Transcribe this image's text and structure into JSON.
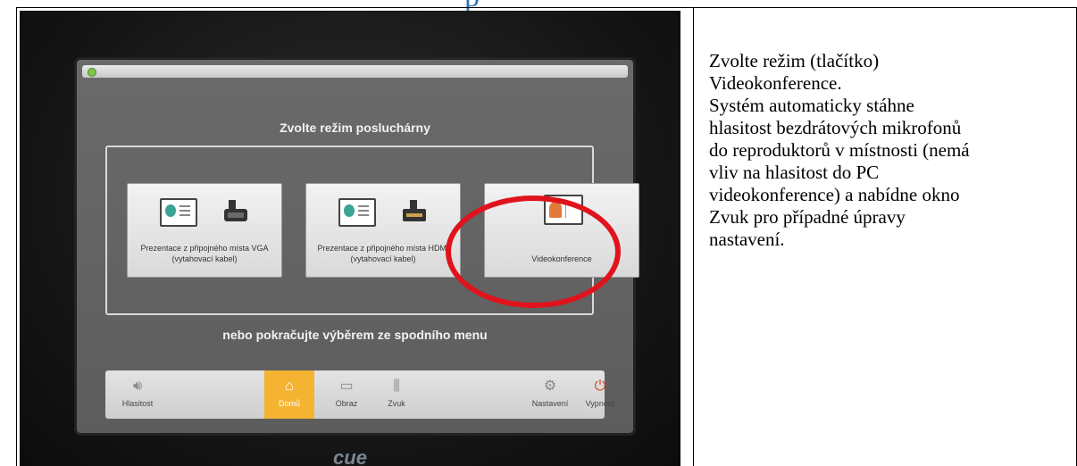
{
  "document": {
    "heading_fragment": "p"
  },
  "photo": {
    "screen": {
      "mode_title": "Zvolte režim posluchárny",
      "tiles": [
        {
          "label": "Prezentace z připojného místa VGA (vytahovací kabel)",
          "icon": "vga-presentation-icon"
        },
        {
          "label": "Prezentace z připojného místa HDMI (vytahovací kabel)",
          "icon": "hdmi-presentation-icon"
        },
        {
          "label": "Videokonference",
          "icon": "videoconference-icon"
        }
      ],
      "subtitle": "nebo pokračujte výběrem ze spodního menu",
      "menu": [
        {
          "label": "Hlasitost",
          "icon": "volume-icon"
        },
        {
          "label": "Domů",
          "icon": "home-icon",
          "active": true
        },
        {
          "label": "Obraz",
          "icon": "picture-icon"
        },
        {
          "label": "Zvuk",
          "icon": "sliders-icon"
        },
        {
          "label": "Nastavení",
          "icon": "gear-icon"
        },
        {
          "label": "Vypnout",
          "icon": "power-icon"
        }
      ],
      "highlight_color": "#e0131c",
      "active_color": "#f4b330"
    },
    "brand": "cue"
  },
  "instructions": {
    "lines": [
      "Zvolte režim (tlačítko)",
      "Videokonference.",
      "Systém automaticky stáhne",
      "hlasitost bezdrátových mikrofonů",
      "do reproduktorů v místnosti (nemá",
      "vliv na hlasitost do PC",
      "videokonference) a nabídne okno",
      "Zvuk pro případné úpravy",
      "nastavení."
    ]
  }
}
